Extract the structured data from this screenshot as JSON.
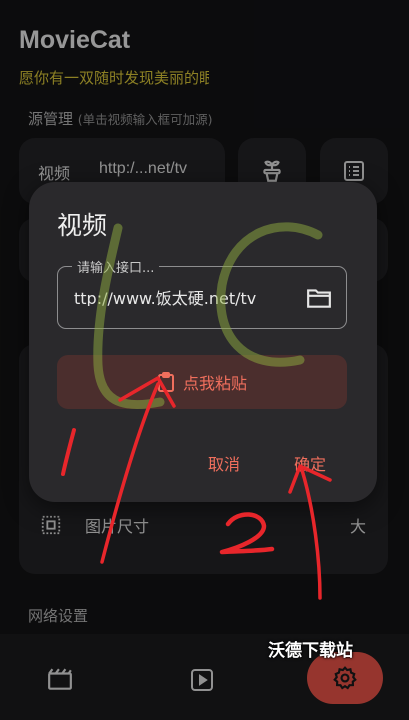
{
  "app": {
    "title": "MovieCat",
    "slogan": "愿你有一双随时发现美丽的眼睛"
  },
  "source_management": {
    "label": "源管理",
    "hint": "(单击视频输入框可加源)",
    "source_type": "视频",
    "source_url": "http:/...net/tv",
    "push_icon": "plant-icon",
    "list_icon": "list-icon"
  },
  "image_size_row": {
    "label": "图片尺寸",
    "value": "大",
    "icon": "frame-icon"
  },
  "network_settings": {
    "label": "网络设置"
  },
  "dialog": {
    "title": "视频",
    "field_label": "请输入接口...",
    "field_value": "ttp://www.饭太硬.net/tv",
    "folder_icon": "folder-icon",
    "paste_label": "点我粘贴",
    "paste_icon": "clipboard-icon",
    "cancel_label": "取消",
    "confirm_label": "确定"
  },
  "bottom_nav": {
    "items": [
      {
        "icon": "film-icon"
      },
      {
        "icon": "play-icon"
      },
      {
        "icon": "settings-icon",
        "active": true
      }
    ]
  },
  "watermark": {
    "text": "沃德下载站"
  },
  "annotations": {
    "label_1": "1",
    "label_2": "2",
    "scribble": "LC",
    "color": "#e8262b"
  },
  "colors": {
    "accent": "#f2564b",
    "accent_text": "#f06f5d",
    "slogan": "#e3cf3b",
    "background": "#141416",
    "card": "#242427"
  }
}
